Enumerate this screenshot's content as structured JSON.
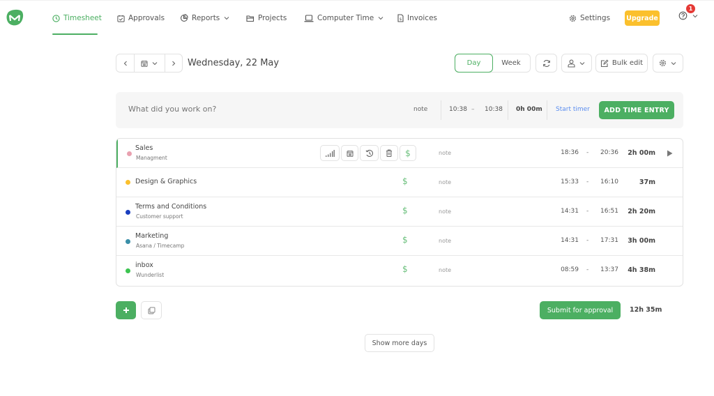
{
  "nav": {
    "items": [
      {
        "label": "Timesheet",
        "icon": "clock-icon",
        "active": true
      },
      {
        "label": "Approvals",
        "icon": "calendar-check-icon"
      },
      {
        "label": "Reports",
        "icon": "pie-chart-icon",
        "dropdown": true
      },
      {
        "label": "Projects",
        "icon": "folder-icon"
      },
      {
        "label": "Computer Time",
        "icon": "laptop-icon",
        "dropdown": true
      },
      {
        "label": "Invoices",
        "icon": "invoice-icon"
      }
    ],
    "settings_label": "Settings",
    "upgrade_label": "Upgrade",
    "notification_count": "1"
  },
  "toolbar": {
    "date_title": "Wednesday, 22 May",
    "view_day": "Day",
    "view_week": "Week",
    "active_view": "Day",
    "bulk_edit_label": "Bulk edit"
  },
  "entry_bar": {
    "placeholder": "What did you work on?",
    "note": "note",
    "start_time": "10:38",
    "separator": "–",
    "end_time": "10:38",
    "duration": "0h 00m",
    "start_timer_label": "Start timer",
    "add_entry_label": "ADD TIME ENTRY"
  },
  "entries": [
    {
      "name": "Sales",
      "sub": "Managment",
      "color": "#e9a1b0",
      "note": "note",
      "start": "18:36",
      "end": "20:36",
      "duration": "2h 00m",
      "active": true
    },
    {
      "name": "Design & Graphics",
      "sub": "",
      "color": "#fbc02d",
      "note": "note",
      "start": "15:33",
      "end": "16:10",
      "duration": "37m"
    },
    {
      "name": "Terms and Conditions",
      "sub": "Customer support",
      "color": "#1a3fbf",
      "note": "note",
      "start": "14:31",
      "end": "16:51",
      "duration": "2h 20m"
    },
    {
      "name": "Marketing",
      "sub": "Asana / Timecamp",
      "color": "#3a8fa8",
      "note": "note",
      "start": "14:31",
      "end": "17:31",
      "duration": "3h 00m"
    },
    {
      "name": "inbox",
      "sub": "Wunderlist",
      "color": "#3cc451",
      "note": "note",
      "start": "08:59",
      "end": "13:37",
      "duration": "4h 38m"
    }
  ],
  "entry_dash": "-",
  "footer": {
    "submit_label": "Submit for approval",
    "total": "12h 35m",
    "show_more_label": "Show more days"
  },
  "colors": {
    "accent": "#4caf62",
    "upgrade": "#fbc02d",
    "link": "#5b8def",
    "badge": "#e53935"
  }
}
